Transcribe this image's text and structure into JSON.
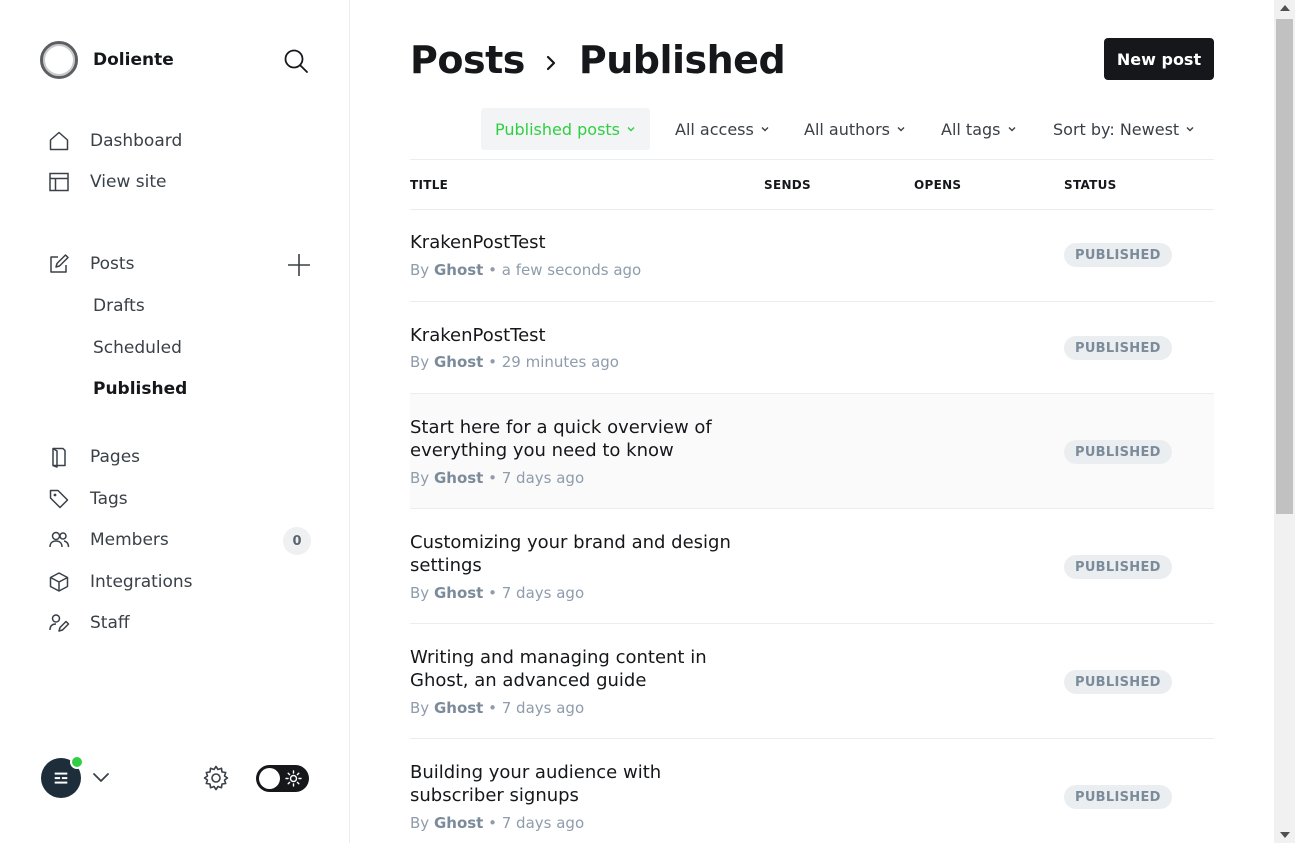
{
  "brand": {
    "name": "Doliente"
  },
  "nav": {
    "dashboard": "Dashboard",
    "view_site": "View site",
    "posts": "Posts",
    "drafts": "Drafts",
    "scheduled": "Scheduled",
    "published": "Published",
    "pages": "Pages",
    "tags": "Tags",
    "members": "Members",
    "members_count": "0",
    "integrations": "Integrations",
    "staff": "Staff"
  },
  "header": {
    "crumb_parent": "Posts",
    "crumb_current": "Published",
    "new_post": "New post"
  },
  "filters": {
    "type": "Published posts",
    "access": "All access",
    "authors": "All authors",
    "tags": "All tags",
    "sort": "Sort by: Newest"
  },
  "columns": {
    "title": "TITLE",
    "sends": "SENDS",
    "opens": "OPENS",
    "status": "STATUS"
  },
  "posts": [
    {
      "title": "KrakenPostTest",
      "by": "By",
      "author": "Ghost",
      "time": "a few seconds ago",
      "status": "PUBLISHED"
    },
    {
      "title": "KrakenPostTest",
      "by": "By",
      "author": "Ghost",
      "time": "29 minutes ago",
      "status": "PUBLISHED"
    },
    {
      "title": "Start here for a quick overview of everything you need to know",
      "by": "By",
      "author": "Ghost",
      "time": "7 days ago",
      "status": "PUBLISHED"
    },
    {
      "title": "Customizing your brand and design settings",
      "by": "By",
      "author": "Ghost",
      "time": "7 days ago",
      "status": "PUBLISHED"
    },
    {
      "title": "Writing and managing content in Ghost, an advanced guide",
      "by": "By",
      "author": "Ghost",
      "time": "7 days ago",
      "status": "PUBLISHED"
    },
    {
      "title": "Building your audience with subscriber signups",
      "by": "By",
      "author": "Ghost",
      "time": "7 days ago",
      "status": "PUBLISHED"
    }
  ],
  "colors": {
    "accent_green": "#30cf43",
    "dark": "#15171a",
    "muted": "#8e9cac"
  }
}
